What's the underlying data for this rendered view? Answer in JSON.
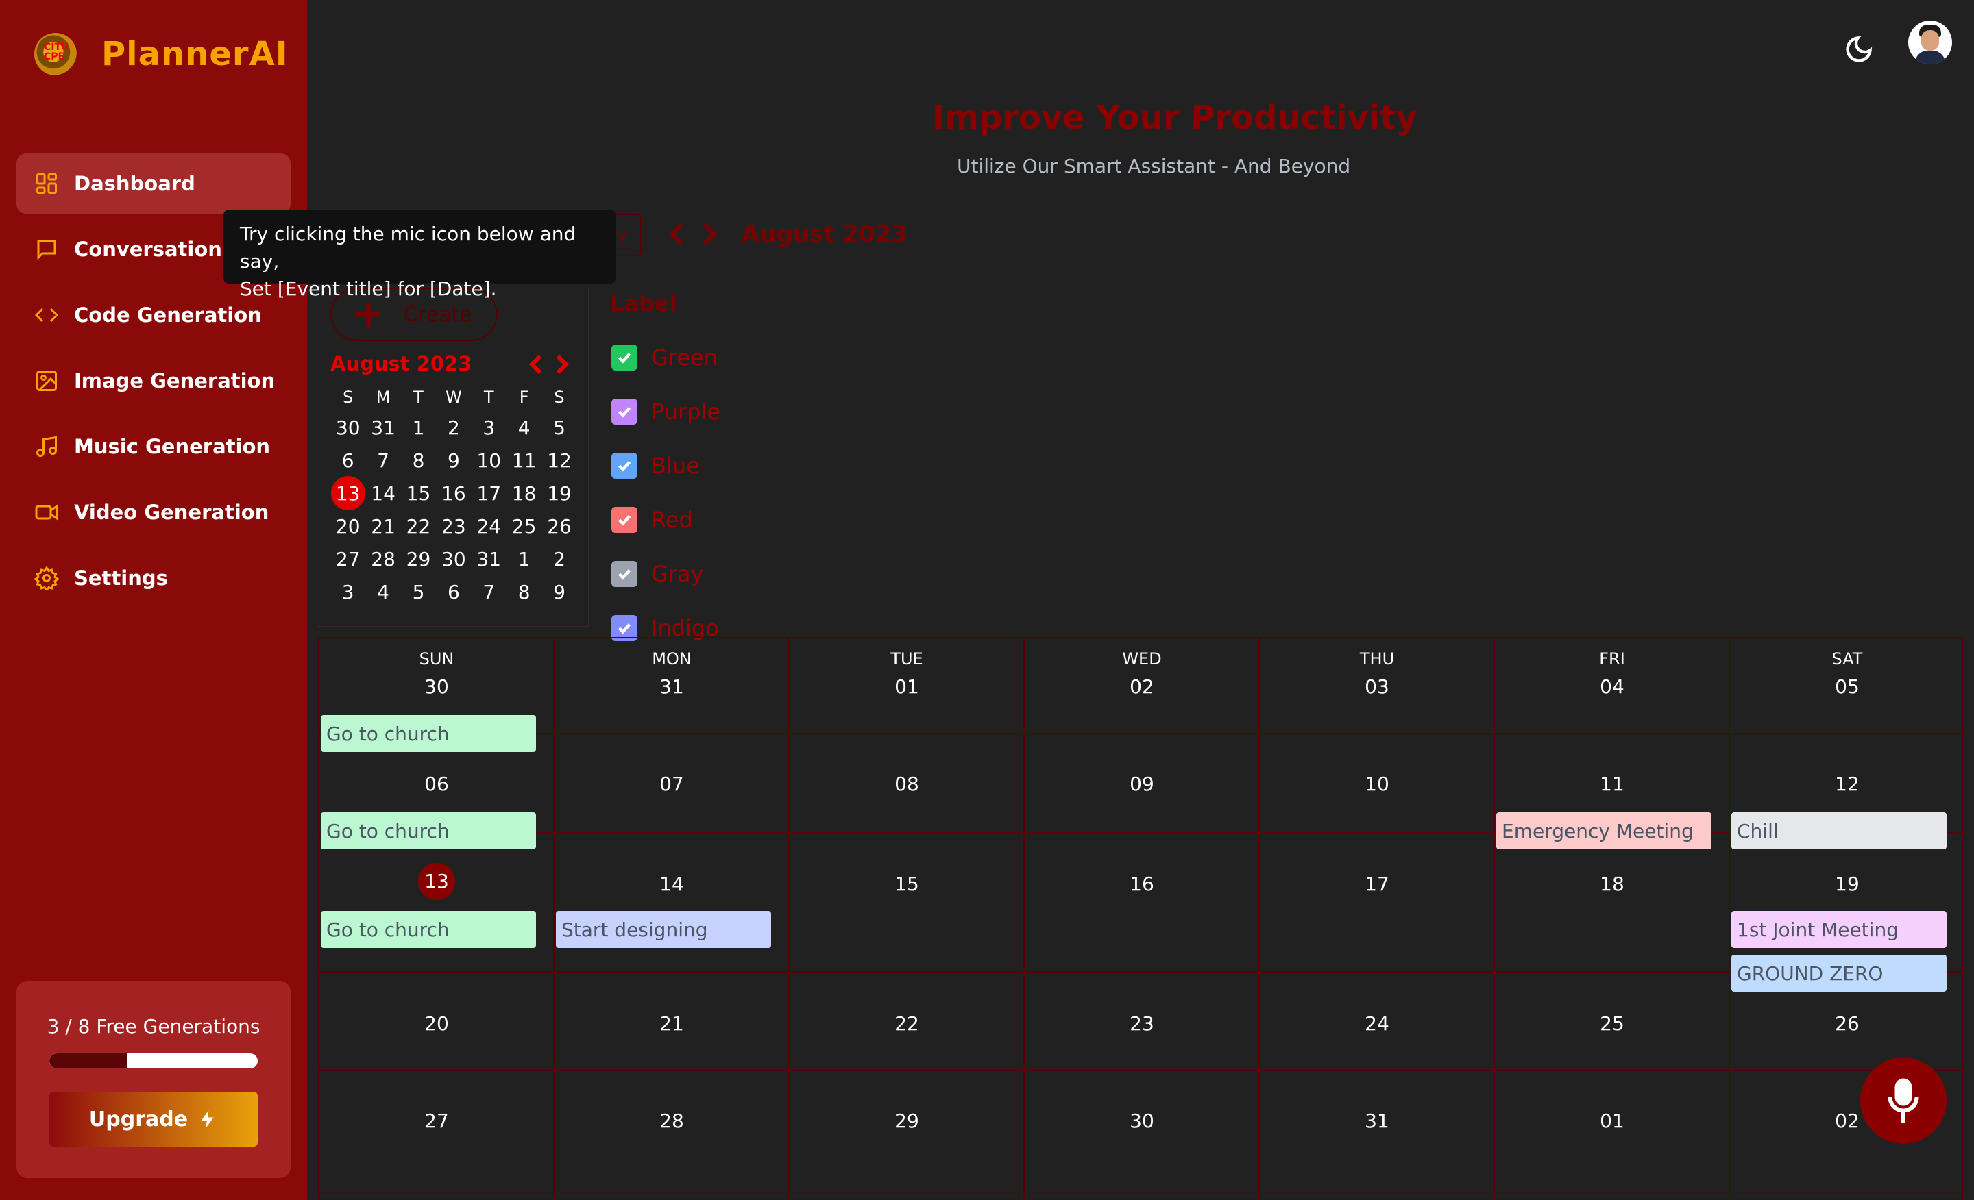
{
  "app": {
    "title": "PlannerAI",
    "logo_text": "CITU CPE"
  },
  "sidebar": {
    "items": [
      {
        "label": "Dashboard",
        "icon": "dashboard-icon",
        "active": true
      },
      {
        "label": "Conversation",
        "icon": "chat-icon"
      },
      {
        "label": "Code Generation",
        "icon": "code-icon"
      },
      {
        "label": "Image Generation",
        "icon": "image-icon"
      },
      {
        "label": "Music Generation",
        "icon": "music-icon"
      },
      {
        "label": "Video Generation",
        "icon": "video-icon"
      },
      {
        "label": "Settings",
        "icon": "gear-icon"
      }
    ],
    "usage": {
      "text": "3 / 8 Free Generations",
      "used": 3,
      "total": 8
    },
    "upgrade_label": "Upgrade"
  },
  "header": {
    "title": "Improve Your Productivity",
    "subtitle": "Utilize Our Smart Assistant - And Beyond"
  },
  "tooltip": {
    "line1": "Try clicking the mic icon below and say,",
    "line2": "Set [Event title] for [Date]."
  },
  "toolbar": {
    "month_title": "August 2023",
    "today_label": "y"
  },
  "mini_calendar": {
    "create_label": "Create",
    "month": "August 2023",
    "weekdays": [
      "S",
      "M",
      "T",
      "W",
      "T",
      "F",
      "S"
    ],
    "weeks": [
      [
        "30",
        "31",
        "1",
        "2",
        "3",
        "4",
        "5"
      ],
      [
        "6",
        "7",
        "8",
        "9",
        "10",
        "11",
        "12"
      ],
      [
        "13",
        "14",
        "15",
        "16",
        "17",
        "18",
        "19"
      ],
      [
        "20",
        "21",
        "22",
        "23",
        "24",
        "25",
        "26"
      ],
      [
        "27",
        "28",
        "29",
        "30",
        "31",
        "1",
        "2"
      ],
      [
        "3",
        "4",
        "5",
        "6",
        "7",
        "8",
        "9"
      ]
    ],
    "today": "13"
  },
  "labels": {
    "title": "Label",
    "items": [
      {
        "name": "Green",
        "color": "#22c55e",
        "checked": true
      },
      {
        "name": "Purple",
        "color": "#c084fc",
        "checked": true
      },
      {
        "name": "Blue",
        "color": "#60a5fa",
        "checked": true
      },
      {
        "name": "Red",
        "color": "#f87171",
        "checked": true
      },
      {
        "name": "Gray",
        "color": "#9ca3af",
        "checked": true
      },
      {
        "name": "Indigo",
        "color": "#818cf8",
        "checked": true
      }
    ]
  },
  "calendar": {
    "day_headers": [
      "SUN",
      "MON",
      "TUE",
      "WED",
      "THU",
      "FRI",
      "SAT"
    ],
    "weeks": [
      [
        "30",
        "31",
        "01",
        "02",
        "03",
        "04",
        "05"
      ],
      [
        "06",
        "07",
        "08",
        "09",
        "10",
        "11",
        "12"
      ],
      [
        "13",
        "14",
        "15",
        "16",
        "17",
        "18",
        "19"
      ],
      [
        "20",
        "21",
        "22",
        "23",
        "24",
        "25",
        "26"
      ],
      [
        "27",
        "28",
        "29",
        "30",
        "31",
        "01",
        "02"
      ]
    ],
    "today": {
      "week": 2,
      "day": 0
    },
    "events": [
      {
        "title": "Go to church",
        "week": 0,
        "day": 0,
        "slot": 0,
        "color": "#bbf7d0"
      },
      {
        "title": "Go to church",
        "week": 1,
        "day": 0,
        "slot": 0,
        "color": "#bbf7d0"
      },
      {
        "title": "Emergency Meeting",
        "week": 1,
        "day": 5,
        "slot": 0,
        "color": "#fecaca"
      },
      {
        "title": "Chill",
        "week": 1,
        "day": 6,
        "slot": 0,
        "color": "#e5e7eb"
      },
      {
        "title": "Go to church",
        "week": 2,
        "day": 0,
        "slot": 0,
        "color": "#bbf7d0"
      },
      {
        "title": "Start designing",
        "week": 2,
        "day": 1,
        "slot": 0,
        "color": "#c7d2fe"
      },
      {
        "title": "1st Joint Meeting",
        "week": 2,
        "day": 6,
        "slot": 0,
        "color": "#f5d0fe"
      },
      {
        "title": "GROUND ZERO",
        "week": 2,
        "day": 6,
        "slot": 1,
        "color": "#bfdbfe"
      }
    ]
  }
}
